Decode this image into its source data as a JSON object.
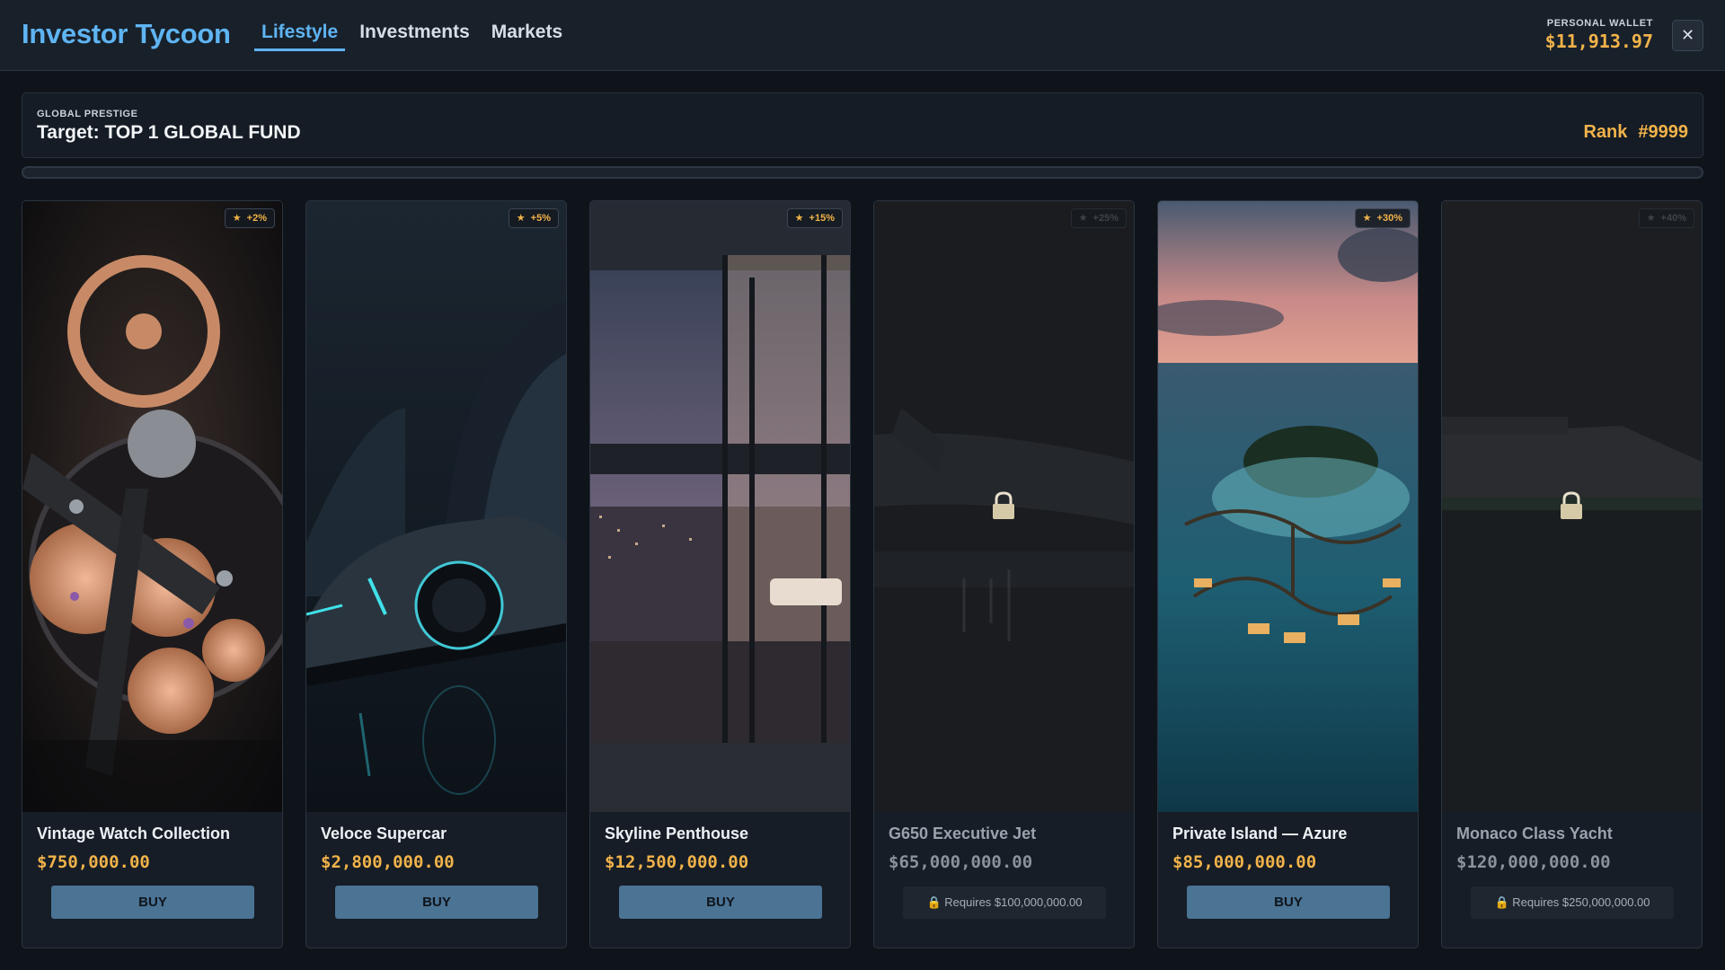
{
  "app": {
    "title": "Investor Tycoon"
  },
  "tabs": [
    {
      "label": "Lifestyle",
      "active": true
    },
    {
      "label": "Investments",
      "active": false
    },
    {
      "label": "Markets",
      "active": false
    }
  ],
  "wallet": {
    "label": "PERSONAL WALLET",
    "value": "$11,913.97"
  },
  "close": {
    "glyph": "✕",
    "icon": "close-icon"
  },
  "prestige": {
    "label": "GLOBAL PRESTIGE",
    "target": "Target: TOP 1 GLOBAL FUND",
    "rank_label": "Rank",
    "rank_value": "#9999",
    "progress": 0
  },
  "cards": [
    {
      "name": "Vintage Watch Collection",
      "price": "$750,000.00",
      "badge": "+2%",
      "star": "★",
      "action": "BUY",
      "locked": false,
      "art": "watch"
    },
    {
      "name": "Veloce Supercar",
      "price": "$2,800,000.00",
      "badge": "+5%",
      "star": "★",
      "action": "BUY",
      "locked": false,
      "art": "supercar"
    },
    {
      "name": "Skyline Penthouse",
      "price": "$12,500,000.00",
      "badge": "+15%",
      "star": "★",
      "action": "BUY",
      "locked": false,
      "art": "penthouse"
    },
    {
      "name": "G650 Executive Jet",
      "price": "$65,000,000.00",
      "badge": "+25%",
      "star": "★",
      "locked": true,
      "requirement": "Requires $100,000,000.00",
      "art": "jet"
    },
    {
      "name": "Private Island — Azure",
      "price": "$85,000,000.00",
      "badge": "+30%",
      "star": "★",
      "action": "BUY",
      "locked": false,
      "art": "island"
    },
    {
      "name": "Monaco Class Yacht",
      "price": "$120,000,000.00",
      "badge": "+40%",
      "star": "★",
      "locked": true,
      "requirement": "Requires $250,000,000.00",
      "art": "yacht"
    }
  ],
  "colors": {
    "accent": "#5fb4f2",
    "gold": "#f2b34a",
    "buy": "#4a7394"
  }
}
